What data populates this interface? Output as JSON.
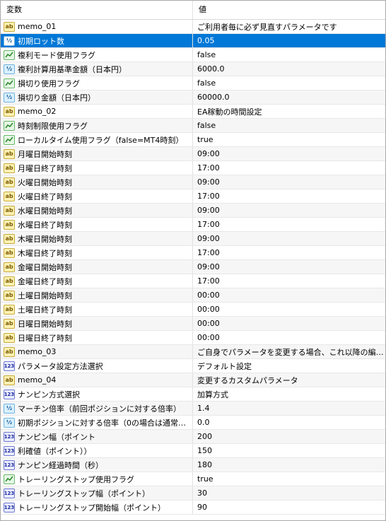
{
  "header": {
    "col_name": "変数",
    "col_value": "値"
  },
  "rows": [
    {
      "icon": "ab",
      "name": "memo_01",
      "value": "ご利用者毎に必ず見直すパラメータです"
    },
    {
      "icon": "v2",
      "name": "初期ロット数",
      "value": "0.05",
      "selected": true
    },
    {
      "icon": "bool",
      "name": "複利モード使用フラグ",
      "value": "false"
    },
    {
      "icon": "v2",
      "name": "複利計算用基準金額（日本円）",
      "value": "6000.0"
    },
    {
      "icon": "bool",
      "name": "損切り使用フラグ",
      "value": "false"
    },
    {
      "icon": "v2",
      "name": "損切り金額（日本円）",
      "value": "60000.0"
    },
    {
      "icon": "ab",
      "name": "memo_02",
      "value": "EA稼動の時間設定"
    },
    {
      "icon": "bool",
      "name": "時刻制限使用フラグ",
      "value": "false"
    },
    {
      "icon": "bool",
      "name": "ローカルタイム使用フラグ（false=MT4時刻）",
      "value": "true"
    },
    {
      "icon": "ab",
      "name": "月曜日開始時刻",
      "value": "09:00"
    },
    {
      "icon": "ab",
      "name": "月曜日終了時刻",
      "value": "17:00"
    },
    {
      "icon": "ab",
      "name": "火曜日開始時刻",
      "value": "09:00"
    },
    {
      "icon": "ab",
      "name": "火曜日終了時刻",
      "value": "17:00"
    },
    {
      "icon": "ab",
      "name": "水曜日開始時刻",
      "value": "09:00"
    },
    {
      "icon": "ab",
      "name": "水曜日終了時刻",
      "value": "17:00"
    },
    {
      "icon": "ab",
      "name": "木曜日開始時刻",
      "value": "09:00"
    },
    {
      "icon": "ab",
      "name": "木曜日終了時刻",
      "value": "17:00"
    },
    {
      "icon": "ab",
      "name": "金曜日開始時刻",
      "value": "09:00"
    },
    {
      "icon": "ab",
      "name": "金曜日終了時刻",
      "value": "17:00"
    },
    {
      "icon": "ab",
      "name": "土曜日開始時刻",
      "value": "00:00"
    },
    {
      "icon": "ab",
      "name": "土曜日終了時刻",
      "value": "00:00"
    },
    {
      "icon": "ab",
      "name": "日曜日開始時刻",
      "value": "00:00"
    },
    {
      "icon": "ab",
      "name": "日曜日終了時刻",
      "value": "00:00"
    },
    {
      "icon": "ab",
      "name": "memo_03",
      "value": "ご自身でパラメータを変更する場合、これ以降の編集を..."
    },
    {
      "icon": "int",
      "name": "パラメータ設定方法選択",
      "value": "デフォルト設定"
    },
    {
      "icon": "ab",
      "name": "memo_04",
      "value": "変更するカスタムパラメータ"
    },
    {
      "icon": "int",
      "name": "ナンピン方式選択",
      "value": "加算方式"
    },
    {
      "icon": "v2",
      "name": "マーチン倍率（前回ポジションに対する倍率）",
      "value": "1.4"
    },
    {
      "icon": "v2",
      "name": "初期ポジションに対する倍率（0の場合は通常の･..",
      "value": "0.0"
    },
    {
      "icon": "int",
      "name": "ナンピン幅（ポイント",
      "value": "200"
    },
    {
      "icon": "int",
      "name": "利確値（ポイント））",
      "value": "150"
    },
    {
      "icon": "int",
      "name": "ナンピン経過時間（秒）",
      "value": "180"
    },
    {
      "icon": "bool",
      "name": "トレーリングストップ使用フラグ",
      "value": "true"
    },
    {
      "icon": "int",
      "name": "トレーリングストップ幅（ポイント）",
      "value": "30"
    },
    {
      "icon": "int",
      "name": "トレーリングストップ開始幅（ポイント）",
      "value": "90"
    }
  ]
}
